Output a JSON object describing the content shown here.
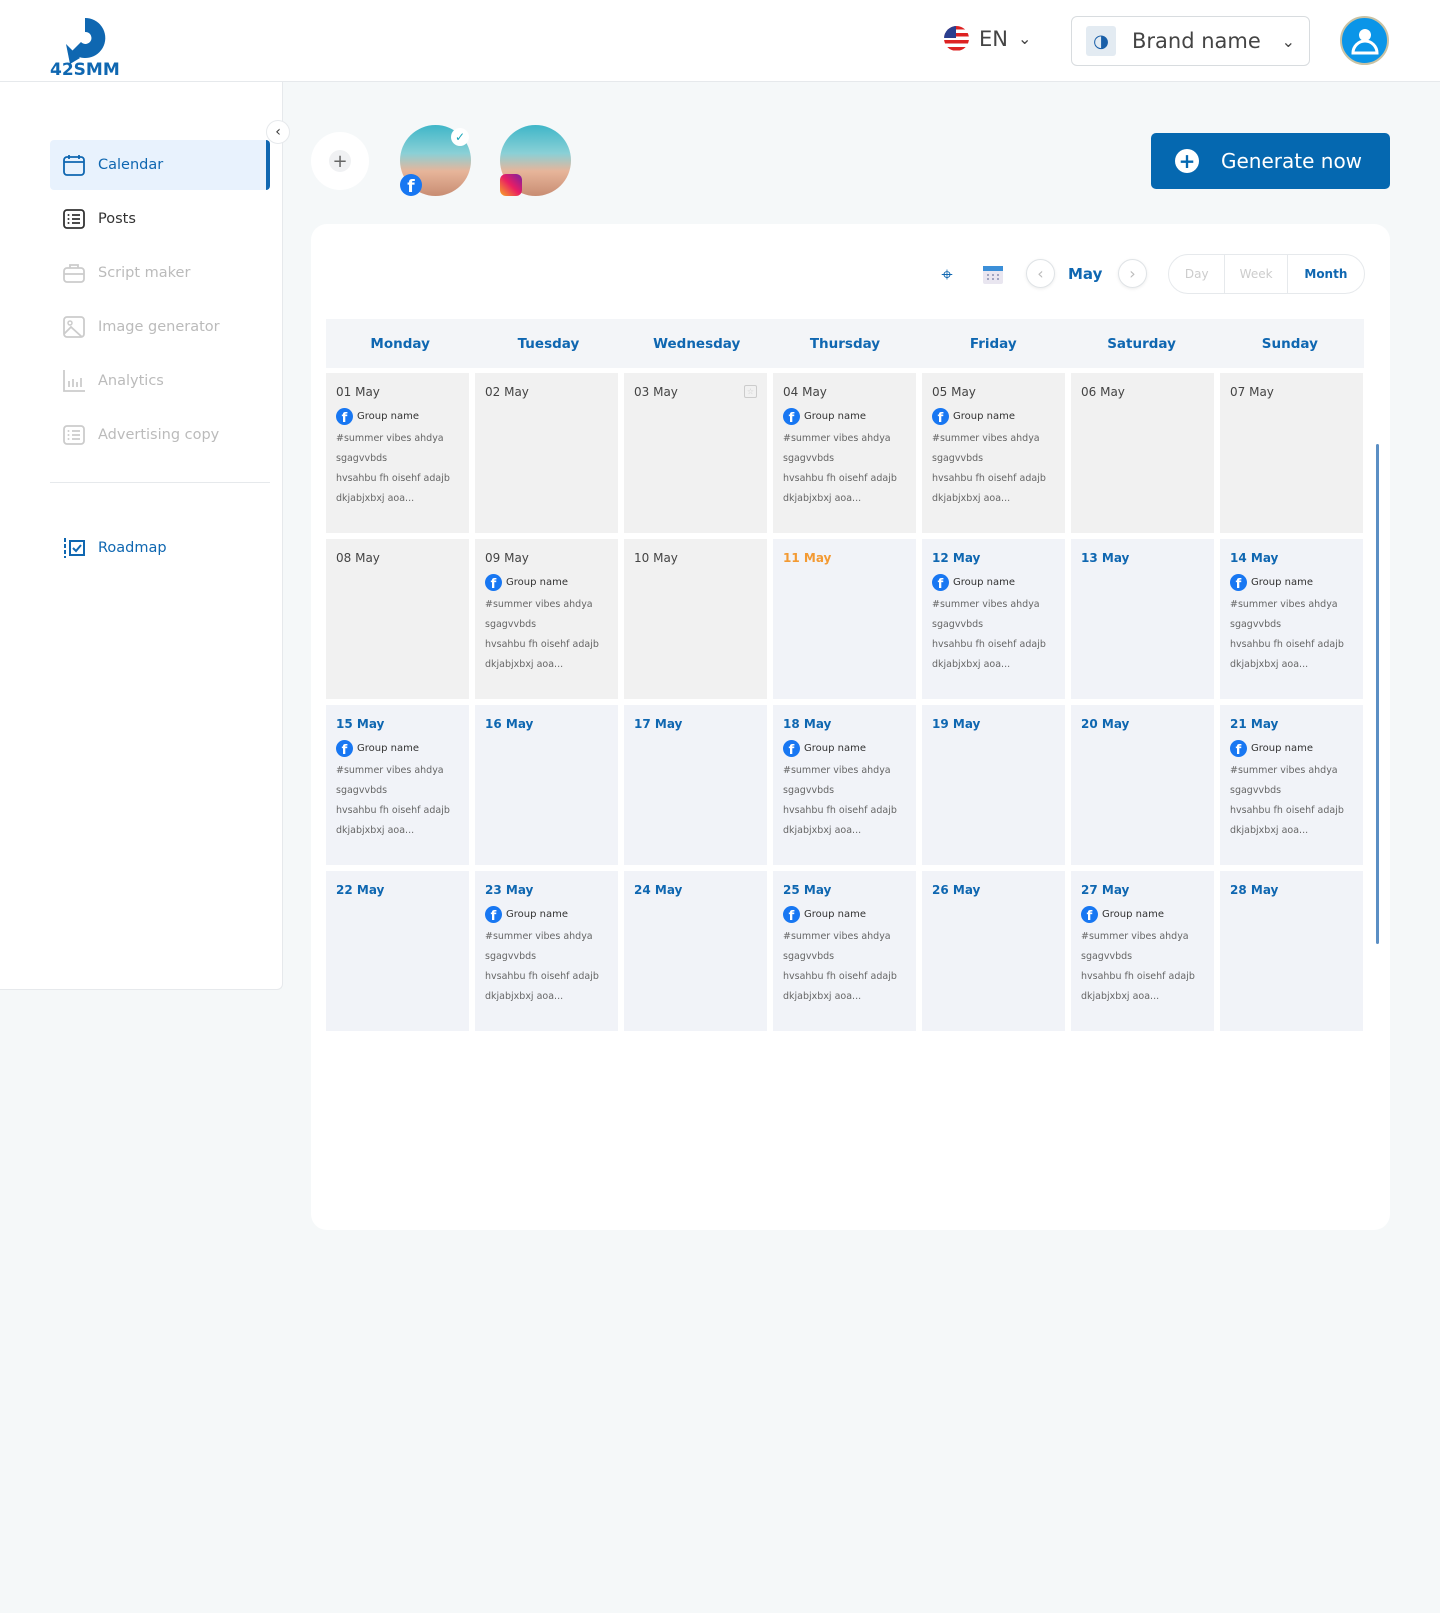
{
  "header": {
    "logo_text": "42SMM",
    "language": "EN",
    "brand": "Brand name"
  },
  "sidebar": {
    "items": [
      {
        "label": "Calendar",
        "icon": "calendar-icon",
        "state": "active"
      },
      {
        "label": "Posts",
        "icon": "list-icon",
        "state": "normal"
      },
      {
        "label": "Script maker",
        "icon": "briefcase-icon",
        "state": "disabled"
      },
      {
        "label": "Image generator",
        "icon": "image-icon",
        "state": "disabled"
      },
      {
        "label": "Analytics",
        "icon": "bar-chart-icon",
        "state": "disabled"
      },
      {
        "label": "Advertising copy",
        "icon": "list-icon",
        "state": "disabled"
      }
    ],
    "roadmap": "Roadmap"
  },
  "accounts": [
    {
      "network": "facebook",
      "selected": true
    },
    {
      "network": "instagram",
      "selected": false
    }
  ],
  "generate_label": "Generate now",
  "calendar": {
    "month": "May",
    "views": [
      "Day",
      "Week",
      "Month"
    ],
    "active_view": "Month",
    "weekdays": [
      "Monday",
      "Tuesday",
      "Wednesday",
      "Thursday",
      "Friday",
      "Saturday",
      "Sunday"
    ],
    "post": {
      "group": "Group name",
      "lines": [
        "#summer  vibes ahdya",
        "sgagvvbds",
        "hvsahbu fh oisehf adajb",
        "dkjabjxbxj aoa..."
      ]
    },
    "cells": [
      {
        "date": "01 May",
        "state": "past",
        "post": true
      },
      {
        "date": "02 May",
        "state": "past",
        "post": false
      },
      {
        "date": "03 May",
        "state": "past",
        "post": false,
        "add_icon": true
      },
      {
        "date": "04 May",
        "state": "past",
        "post": true
      },
      {
        "date": "05 May",
        "state": "past",
        "post": true
      },
      {
        "date": "06 May",
        "state": "past",
        "post": false
      },
      {
        "date": "07 May",
        "state": "past",
        "post": false
      },
      {
        "date": "08 May",
        "state": "past",
        "post": false
      },
      {
        "date": "09 May",
        "state": "past",
        "post": true
      },
      {
        "date": "10 May",
        "state": "past",
        "post": false
      },
      {
        "date": "11 May",
        "state": "today",
        "post": false
      },
      {
        "date": "12 May",
        "state": "future",
        "post": true
      },
      {
        "date": "13 May",
        "state": "future",
        "post": false
      },
      {
        "date": "14 May",
        "state": "future",
        "post": true
      },
      {
        "date": "15 May",
        "state": "future",
        "post": true
      },
      {
        "date": "16 May",
        "state": "future",
        "post": false
      },
      {
        "date": "17 May",
        "state": "future",
        "post": false
      },
      {
        "date": "18 May",
        "state": "future",
        "post": true
      },
      {
        "date": "19 May",
        "state": "future",
        "post": false
      },
      {
        "date": "20 May",
        "state": "future",
        "post": false
      },
      {
        "date": "21 May",
        "state": "future",
        "post": true
      },
      {
        "date": "22 May",
        "state": "future",
        "post": false
      },
      {
        "date": "23 May",
        "state": "future",
        "post": true
      },
      {
        "date": "24 May",
        "state": "future",
        "post": false
      },
      {
        "date": "25 May",
        "state": "future",
        "post": true
      },
      {
        "date": "26 May",
        "state": "future",
        "post": false
      },
      {
        "date": "27 May",
        "state": "future",
        "post": true
      },
      {
        "date": "28 May",
        "state": "future",
        "post": false
      }
    ]
  },
  "colors": {
    "primary": "#0568b0",
    "today": "#f39a33",
    "facebook": "#1877f2"
  }
}
